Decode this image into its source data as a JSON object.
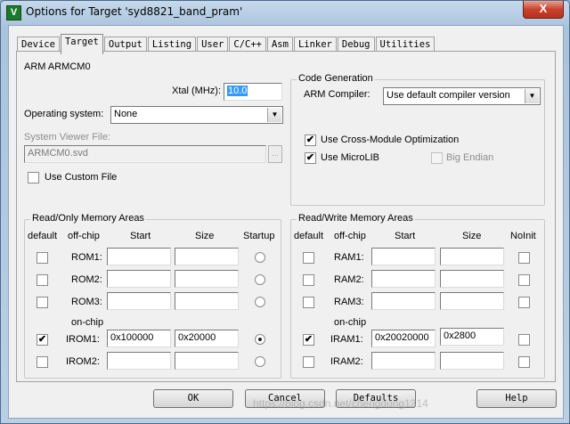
{
  "window": {
    "title": "Options for Target 'syd8821_band_pram'",
    "close_label": "X",
    "app_icon": "V"
  },
  "tabs": [
    "Device",
    "Target",
    "Output",
    "Listing",
    "User",
    "C/C++",
    "Asm",
    "Linker",
    "Debug",
    "Utilities"
  ],
  "active_tab": "Target",
  "device_name": "ARM ARMCM0",
  "xtal": {
    "label": "Xtal (MHz):",
    "value": "10.0"
  },
  "os": {
    "label": "Operating system:",
    "value": "None"
  },
  "svd": {
    "label": "System Viewer File:",
    "value": "ARMCM0.svd",
    "browse": "..."
  },
  "custom_file": {
    "label": "Use Custom File",
    "checked": false
  },
  "code_gen": {
    "title": "Code Generation",
    "compiler_label": "ARM Compiler:",
    "compiler_value": "Use default compiler version",
    "cross_module": {
      "label": "Use Cross-Module Optimization",
      "checked": true
    },
    "microlib": {
      "label": "Use MicroLIB",
      "checked": true
    },
    "big_endian": {
      "label": "Big Endian",
      "checked": false
    }
  },
  "ro_mem": {
    "title": "Read/Only Memory Areas",
    "headers": {
      "default": "default",
      "offchip": "off-chip",
      "start": "Start",
      "size": "Size",
      "startup": "Startup"
    },
    "onchip_label": "on-chip",
    "rows": [
      {
        "name": "ROM1:",
        "start": "",
        "size": "",
        "default": false,
        "startup": false
      },
      {
        "name": "ROM2:",
        "start": "",
        "size": "",
        "default": false,
        "startup": false
      },
      {
        "name": "ROM3:",
        "start": "",
        "size": "",
        "default": false,
        "startup": false
      },
      {
        "name": "IROM1:",
        "start": "0x100000",
        "size": "0x20000",
        "default": true,
        "startup": true
      },
      {
        "name": "IROM2:",
        "start": "",
        "size": "",
        "default": false,
        "startup": false
      }
    ]
  },
  "rw_mem": {
    "title": "Read/Write Memory Areas",
    "headers": {
      "default": "default",
      "offchip": "off-chip",
      "start": "Start",
      "size": "Size",
      "noinit": "NoInit"
    },
    "onchip_label": "on-chip",
    "rows": [
      {
        "name": "RAM1:",
        "start": "",
        "size": "",
        "default": false,
        "noinit": false
      },
      {
        "name": "RAM2:",
        "start": "",
        "size": "",
        "default": false,
        "noinit": false
      },
      {
        "name": "RAM3:",
        "start": "",
        "size": "",
        "default": false,
        "noinit": false
      },
      {
        "name": "IRAM1:",
        "start": "0x20020000",
        "size": "0x2800",
        "default": true,
        "noinit": false
      },
      {
        "name": "IRAM2:",
        "start": "",
        "size": "",
        "default": false,
        "noinit": false
      }
    ]
  },
  "buttons": {
    "ok": "OK",
    "cancel": "Cancel",
    "defaults": "Defaults",
    "help": "Help"
  },
  "watermark": "https://blog.csdn.net/chengdong1314"
}
